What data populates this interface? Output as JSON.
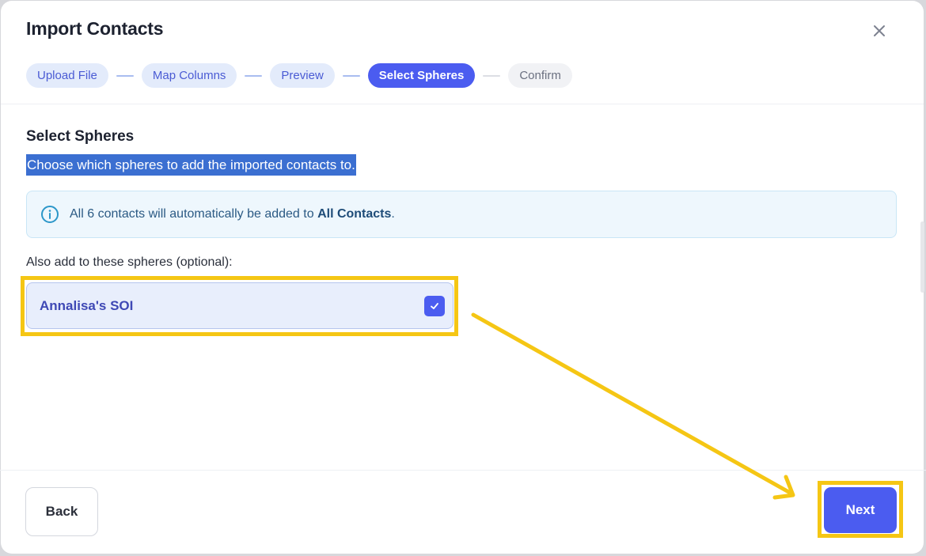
{
  "dialog": {
    "title": "Import Contacts",
    "close_icon": "close-icon"
  },
  "steps": [
    {
      "label": "Upload File",
      "state": "completed"
    },
    {
      "label": "Map Columns",
      "state": "completed"
    },
    {
      "label": "Preview",
      "state": "completed"
    },
    {
      "label": "Select Spheres",
      "state": "active"
    },
    {
      "label": "Confirm",
      "state": "upcoming"
    }
  ],
  "content": {
    "heading": "Select Spheres",
    "subtitle": "Choose which spheres to add the imported contacts to.",
    "info": {
      "icon": "info-icon",
      "prefix": "All 6 contacts will automatically be added to ",
      "emphasis": "All Contacts",
      "suffix": "."
    },
    "also_label": "Also add to these spheres (optional):",
    "spheres": [
      {
        "label": "Annalisa's SOI",
        "checked": true
      }
    ]
  },
  "footer": {
    "back_label": "Back",
    "next_label": "Next"
  },
  "colors": {
    "accent": "#4b5cf0",
    "highlight": "#f5c614",
    "selection": "#3b6fd1"
  }
}
